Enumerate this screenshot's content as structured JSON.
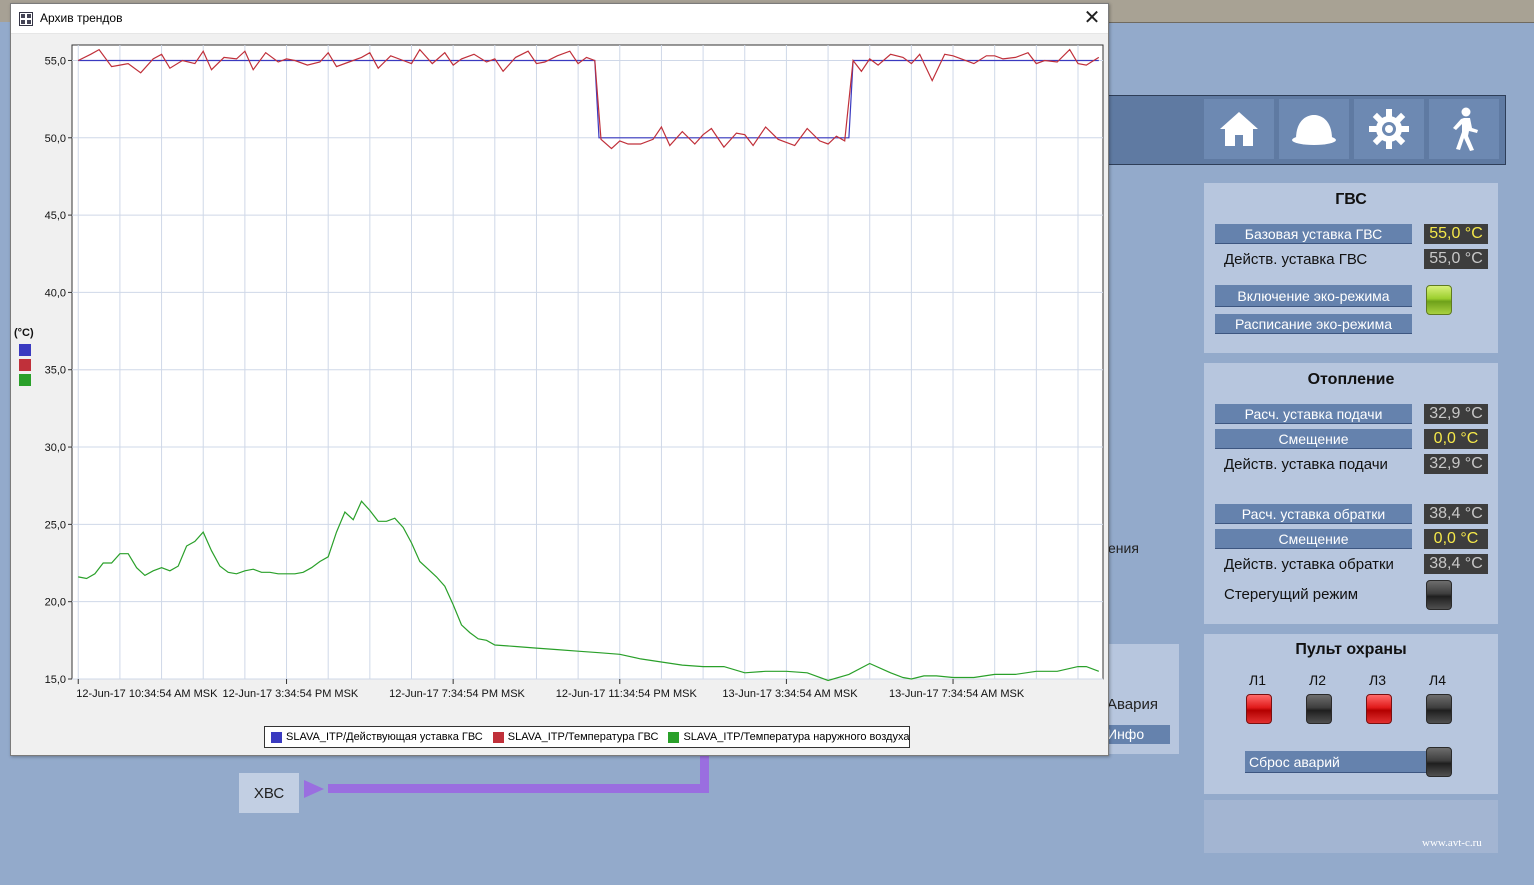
{
  "window": {
    "title": "Архив трендов",
    "close_glyph": "✕",
    "icon": "grid-icon"
  },
  "chart_data": {
    "type": "line",
    "ylabel": "(°C)",
    "ylim": [
      15.0,
      56.0
    ],
    "yticks": [
      "55,0",
      "50,0",
      "45,0",
      "40,0",
      "35,0",
      "30,0",
      "25,0",
      "20,0",
      "15,0"
    ],
    "ytick_values": [
      55,
      50,
      45,
      40,
      35,
      30,
      25,
      20,
      15
    ],
    "xticks": [
      "12-Jun-17 10:34:54 AM MSK",
      "12-Jun-17 3:34:54 PM MSK",
      "12-Jun-17 7:34:54 PM MSK",
      "12-Jun-17 11:34:54 PM MSK",
      "13-Jun-17 3:34:54 AM MSK",
      "13-Jun-17 7:34:54 AM MSK"
    ],
    "xtick_hours": [
      0,
      5,
      9,
      13,
      17,
      21
    ],
    "xlim_hours": [
      -0.15,
      24.6
    ],
    "grid": true,
    "legend_position": "bottom",
    "series": [
      {
        "name": "SLAVA_ITP/Действующая уставка ГВС",
        "color": "#3a3ac0",
        "x": [
          0,
          12.4,
          12.5,
          18.5,
          18.6,
          24.5
        ],
        "values": [
          55.0,
          55.0,
          50.0,
          50.0,
          55.0,
          55.0
        ]
      },
      {
        "name": "SLAVA_ITP/Температура ГВС",
        "color": "#c0303a",
        "x": [
          0,
          0.3,
          0.5,
          0.8,
          1.0,
          1.2,
          1.5,
          1.8,
          2.0,
          2.2,
          2.5,
          2.8,
          3.0,
          3.2,
          3.5,
          3.8,
          4.0,
          4.2,
          4.5,
          4.8,
          5.0,
          5.2,
          5.5,
          5.8,
          6.0,
          6.2,
          6.5,
          6.8,
          7.0,
          7.2,
          7.5,
          7.8,
          8.0,
          8.2,
          8.5,
          8.8,
          9.0,
          9.2,
          9.5,
          9.8,
          10.0,
          10.2,
          10.5,
          10.8,
          11.0,
          11.2,
          11.5,
          11.8,
          12.0,
          12.2,
          12.4,
          12.55,
          12.8,
          13.0,
          13.2,
          13.5,
          13.8,
          14.0,
          14.2,
          14.5,
          14.8,
          15.0,
          15.2,
          15.5,
          15.8,
          16.0,
          16.2,
          16.5,
          16.8,
          17.0,
          17.2,
          17.5,
          17.8,
          18.0,
          18.2,
          18.4,
          18.6,
          18.8,
          19.0,
          19.2,
          19.5,
          19.8,
          20.0,
          20.2,
          20.5,
          20.8,
          21.0,
          21.2,
          21.5,
          21.8,
          22.0,
          22.2,
          22.5,
          22.8,
          23.0,
          23.2,
          23.5,
          23.8,
          24.0,
          24.2,
          24.5
        ],
        "values": [
          55.0,
          55.4,
          55.7,
          54.6,
          54.7,
          54.8,
          54.2,
          55.1,
          55.4,
          54.5,
          55.0,
          54.8,
          55.6,
          54.4,
          55.2,
          55.1,
          55.6,
          54.4,
          55.5,
          54.9,
          55.1,
          55.0,
          54.7,
          54.9,
          55.5,
          54.6,
          54.9,
          55.2,
          55.5,
          54.5,
          55.3,
          55.0,
          54.8,
          55.7,
          54.8,
          55.5,
          54.7,
          55.1,
          55.4,
          54.9,
          55.1,
          54.3,
          55.2,
          55.6,
          54.8,
          54.9,
          55.3,
          55.6,
          54.8,
          55.2,
          55.0,
          49.9,
          49.3,
          49.8,
          49.6,
          49.6,
          49.9,
          50.7,
          49.5,
          50.4,
          49.6,
          50.2,
          50.6,
          49.4,
          50.3,
          50.2,
          49.5,
          50.7,
          49.9,
          49.7,
          49.5,
          50.6,
          49.8,
          49.6,
          50.1,
          49.8,
          55.0,
          54.3,
          55.1,
          54.7,
          55.4,
          55.2,
          54.8,
          55.4,
          53.7,
          55.4,
          55.3,
          55.1,
          54.8,
          55.3,
          55.3,
          55.1,
          55.2,
          55.5,
          54.8,
          55.0,
          54.9,
          55.7,
          54.8,
          54.7,
          55.2
        ]
      },
      {
        "name": "SLAVA_ITP/Температура наружного воздуха",
        "color": "#2aa02a",
        "x": [
          0,
          0.2,
          0.4,
          0.6,
          0.8,
          1.0,
          1.2,
          1.4,
          1.6,
          1.8,
          2.0,
          2.2,
          2.4,
          2.6,
          2.8,
          3.0,
          3.2,
          3.4,
          3.6,
          3.8,
          4.0,
          4.2,
          4.4,
          4.6,
          4.8,
          5.0,
          5.2,
          5.4,
          5.6,
          5.8,
          6.0,
          6.2,
          6.4,
          6.6,
          6.8,
          7.0,
          7.2,
          7.4,
          7.6,
          7.8,
          8.0,
          8.2,
          8.4,
          8.6,
          8.8,
          9.0,
          9.2,
          9.4,
          9.6,
          9.8,
          10.0,
          10.5,
          11.0,
          11.5,
          12.0,
          12.5,
          13.0,
          13.5,
          14.0,
          14.5,
          15.0,
          15.5,
          16.0,
          16.5,
          17.0,
          17.5,
          18.0,
          18.5,
          19.0,
          19.5,
          19.8,
          20.0,
          20.3,
          20.6,
          21.0,
          21.5,
          22.0,
          22.5,
          23.0,
          23.5,
          24.0,
          24.2,
          24.5
        ],
        "values": [
          21.6,
          21.5,
          21.8,
          22.5,
          22.5,
          23.1,
          23.1,
          22.2,
          21.7,
          22.0,
          22.2,
          22.0,
          22.3,
          23.6,
          23.9,
          24.5,
          23.3,
          22.3,
          21.9,
          21.8,
          22.0,
          22.1,
          21.9,
          21.9,
          21.8,
          21.8,
          21.8,
          21.9,
          22.2,
          22.6,
          22.9,
          24.5,
          25.8,
          25.3,
          26.5,
          25.9,
          25.2,
          25.2,
          25.4,
          24.8,
          23.8,
          22.6,
          22.1,
          21.6,
          21.0,
          19.8,
          18.5,
          18.0,
          17.6,
          17.5,
          17.2,
          17.1,
          17.0,
          16.9,
          16.8,
          16.7,
          16.6,
          16.3,
          16.1,
          15.9,
          15.8,
          15.8,
          15.4,
          15.5,
          15.5,
          15.4,
          14.9,
          15.3,
          16.0,
          15.4,
          15.1,
          15.0,
          15.2,
          15.2,
          15.1,
          15.1,
          15.3,
          15.3,
          15.5,
          15.5,
          15.8,
          15.8,
          15.5
        ]
      }
    ]
  },
  "behind": {
    "xvs_label": "ХВС",
    "partial_label_1": "ения",
    "partial_label_2": "Авария",
    "partial_label_3": "Инфо"
  },
  "nav": {
    "buttons": [
      "home-icon",
      "helmet-icon",
      "gear-icon",
      "exit-icon"
    ]
  },
  "gvs": {
    "title": "ГВС",
    "base_setpoint_label": "Базовая уставка ГВС",
    "base_setpoint_value": "55,0 °C",
    "eff_setpoint_label": "Действ. уставка ГВС",
    "eff_setpoint_value": "55,0 °C",
    "eco_enable_label": "Включение эко-режима",
    "eco_schedule_label": "Расписание эко-режима"
  },
  "heating": {
    "title": "Отопление",
    "calc_supply_label": "Расч. уставка подачи",
    "calc_supply_value": "32,9 °C",
    "offset1_label": "Смещение",
    "offset1_value": "0,0 °C",
    "eff_supply_label": "Действ. уставка подачи",
    "eff_supply_value": "32,9 °C",
    "calc_return_label": "Расч. уставка обратки",
    "calc_return_value": "38,4 °C",
    "offset2_label": "Смещение",
    "offset2_value": "0,0 °C",
    "eff_return_label": "Действ. уставка обратки",
    "eff_return_value": "38,4 °C",
    "guard_mode_label": "Стерегущий режим"
  },
  "security": {
    "title": "Пульт охраны",
    "lines": [
      {
        "label": "Л1",
        "state": "alarm"
      },
      {
        "label": "Л2",
        "state": "off"
      },
      {
        "label": "Л3",
        "state": "alarm"
      },
      {
        "label": "Л4",
        "state": "off"
      }
    ],
    "reset_label": "Сброс аварий"
  },
  "footer": {
    "site": "www.avt-c.ru"
  }
}
